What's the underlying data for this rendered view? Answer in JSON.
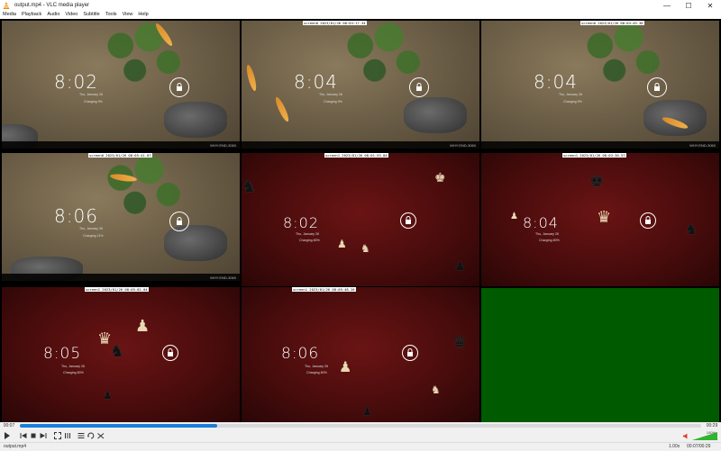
{
  "window": {
    "title": "output.mp4 - VLC media player",
    "minimize": "—",
    "maximize": "☐",
    "close": "✕"
  },
  "menu": [
    "Media",
    "Playback",
    "Audio",
    "Video",
    "Subtitle",
    "Tools",
    "View",
    "Help"
  ],
  "tiles": [
    {
      "kind": "garden",
      "clock": "8:02",
      "date": "Thu, January 26",
      "charge": "Charging 9%",
      "stamp": "screen0 2023/01/26 08:01:52.06",
      "status": "WHY:END-3060"
    },
    {
      "kind": "garden",
      "clock": "8:04",
      "date": "Thu, January 26",
      "charge": "Charging 9%",
      "stamp": "screen0 2023/01/26 08:03:17.34",
      "status": "WHY:END-3060"
    },
    {
      "kind": "garden",
      "clock": "8:04",
      "date": "Thu, January 26",
      "charge": "Charging 9%",
      "stamp": "screen0 2023/01/26 08:03:49.36",
      "status": "WHY:END-3060"
    },
    {
      "kind": "garden",
      "clock": "8:06",
      "date": "Thu, January 26",
      "charge": "Charging 11%",
      "stamp": "screen0 2023/01/26 08:05:41.07",
      "status": "WHY:END-3060"
    },
    {
      "kind": "chess",
      "clock": "8:02",
      "date": "Thu, January 26",
      "charge": "Charging 80%",
      "stamp": "screen1 2023/01/26 08:01:53.04",
      "status": ""
    },
    {
      "kind": "chess",
      "clock": "8:04",
      "date": "Thu, January 26",
      "charge": "Charging 80%",
      "stamp": "screen1 2023/01/26 08:03:30.57",
      "status": ""
    },
    {
      "kind": "chess",
      "clock": "8:05",
      "date": "Thu, January 26",
      "charge": "Charging 80%",
      "stamp": "screen1 2023/01/26 08:05:02.04",
      "status": ""
    },
    {
      "kind": "chess",
      "clock": "8:06",
      "date": "Thu, January 26",
      "charge": "Charging 80%",
      "stamp": "screen1 2023/01/26 08:05:48.26",
      "status": ""
    },
    {
      "kind": "green"
    }
  ],
  "seek": {
    "elapsed": "00:07",
    "total": "00:29",
    "progress": 0.29
  },
  "volume": {
    "label": "100%",
    "level": 1.0
  },
  "statusbar": {
    "file": "output.mp4",
    "speed": "1.00x",
    "time": "00:07/00:29"
  },
  "colors": {
    "accent": "#1a7fd9",
    "green_tile": "#005a00",
    "volume_green": "#2fb52f"
  }
}
